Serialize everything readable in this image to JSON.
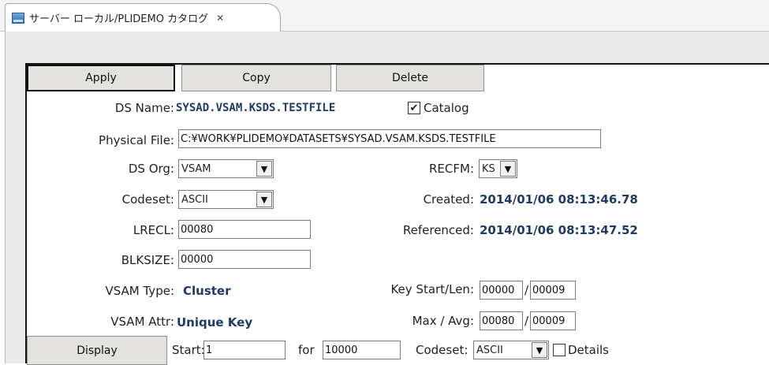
{
  "tab": {
    "title": "サーバー ローカル/PLIDEMO カタログ",
    "close_icon": "close-x"
  },
  "toolbar": {
    "apply": "Apply",
    "copy": "Copy",
    "delete": "Delete"
  },
  "form": {
    "ds_name_label": "DS Name:",
    "ds_name_value": "SYSAD.VSAM.KSDS.TESTFILE",
    "catalog_label": "Catalog",
    "catalog_checked": true,
    "physical_file_label": "Physical File:",
    "physical_file_value": "C:¥WORK¥PLIDEMO¥DATASETS¥SYSAD.VSAM.KSDS.TESTFILE",
    "ds_org_label": "DS Org:",
    "ds_org_value": "VSAM",
    "recfm_label": "RECFM:",
    "recfm_value": "KS",
    "codeset_label": "Codeset:",
    "codeset_value": "ASCII",
    "created_label": "Created:",
    "created_value": "2014/01/06 08:13:46.78",
    "lrecl_label": "LRECL:",
    "lrecl_value": "00080",
    "referenced_label": "Referenced:",
    "referenced_value": "2014/01/06 08:13:47.52",
    "blksize_label": "BLKSIZE:",
    "blksize_value": "00000",
    "vsam_type_label": "VSAM Type:",
    "vsam_type_value": "Cluster",
    "key_start_len_label": "Key Start/Len:",
    "key_start_value": "00000",
    "key_len_value": "00009",
    "vsam_attr_label": "VSAM Attr:",
    "vsam_attr_value": "Unique Key",
    "max_avg_label": "Max / Avg:",
    "max_value": "00080",
    "avg_value": "00009"
  },
  "display_bar": {
    "display_button": "Display",
    "start_label": "Start:",
    "start_value": "1",
    "for_label": "for",
    "for_value": "10000",
    "codeset_label": "Codeset:",
    "codeset_value": "ASCII",
    "details_label": "Details",
    "details_checked": false
  }
}
